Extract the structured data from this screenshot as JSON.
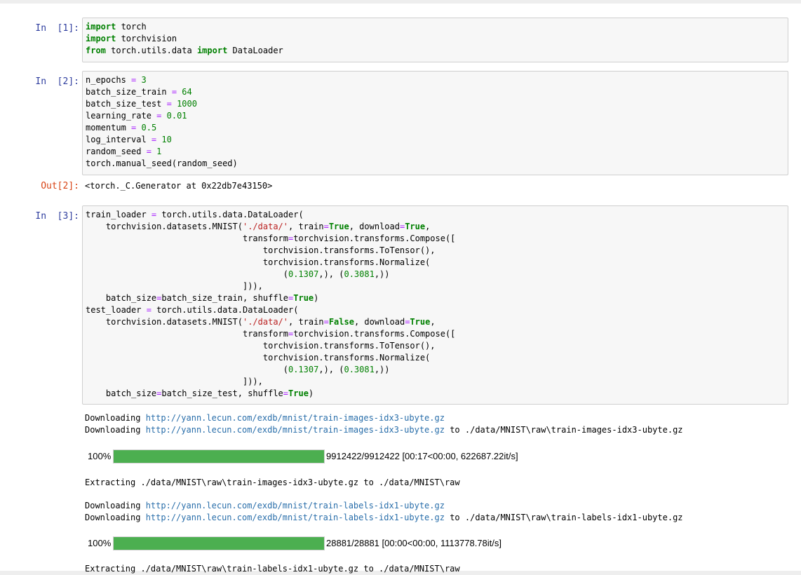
{
  "cells": {
    "c1": {
      "prompt": "In  [1]:",
      "lines": [
        [
          {
            "t": "import",
            "c": "kw"
          },
          {
            "t": " torch"
          }
        ],
        [
          {
            "t": "import",
            "c": "kw"
          },
          {
            "t": " torchvision"
          }
        ],
        [
          {
            "t": "from",
            "c": "kw"
          },
          {
            "t": " torch.utils.data "
          },
          {
            "t": "import",
            "c": "kw"
          },
          {
            "t": " DataLoader"
          }
        ]
      ]
    },
    "c2": {
      "prompt": "In  [2]:",
      "lines": [
        [
          {
            "t": "n_epochs "
          },
          {
            "t": "=",
            "c": "op"
          },
          {
            "t": " "
          },
          {
            "t": "3",
            "c": "num"
          }
        ],
        [
          {
            "t": "batch_size_train "
          },
          {
            "t": "=",
            "c": "op"
          },
          {
            "t": " "
          },
          {
            "t": "64",
            "c": "num"
          }
        ],
        [
          {
            "t": "batch_size_test "
          },
          {
            "t": "=",
            "c": "op"
          },
          {
            "t": " "
          },
          {
            "t": "1000",
            "c": "num"
          }
        ],
        [
          {
            "t": "learning_rate "
          },
          {
            "t": "=",
            "c": "op"
          },
          {
            "t": " "
          },
          {
            "t": "0.01",
            "c": "num"
          }
        ],
        [
          {
            "t": "momentum "
          },
          {
            "t": "=",
            "c": "op"
          },
          {
            "t": " "
          },
          {
            "t": "0.5",
            "c": "num"
          }
        ],
        [
          {
            "t": "log_interval "
          },
          {
            "t": "=",
            "c": "op"
          },
          {
            "t": " "
          },
          {
            "t": "10",
            "c": "num"
          }
        ],
        [
          {
            "t": "random_seed "
          },
          {
            "t": "=",
            "c": "op"
          },
          {
            "t": " "
          },
          {
            "t": "1",
            "c": "num"
          }
        ],
        [
          {
            "t": "torch.manual_seed(random_seed)"
          }
        ]
      ],
      "out_prompt": "Out[2]:",
      "output": "<torch._C.Generator at 0x22db7e43150>"
    },
    "c3": {
      "prompt": "In  [3]:",
      "lines": [
        [
          {
            "t": "train_loader "
          },
          {
            "t": "=",
            "c": "op"
          },
          {
            "t": " torch.utils.data.DataLoader("
          }
        ],
        [
          {
            "t": "    torchvision.datasets.MNIST("
          },
          {
            "t": "'./data/'",
            "c": "str"
          },
          {
            "t": ", train"
          },
          {
            "t": "=",
            "c": "op"
          },
          {
            "t": "True",
            "c": "kw"
          },
          {
            "t": ", download"
          },
          {
            "t": "=",
            "c": "op"
          },
          {
            "t": "True",
            "c": "kw"
          },
          {
            "t": ","
          }
        ],
        [
          {
            "t": "                               transform"
          },
          {
            "t": "=",
            "c": "op"
          },
          {
            "t": "torchvision.transforms.Compose(["
          }
        ],
        [
          {
            "t": "                                   torchvision.transforms.ToTensor(),"
          }
        ],
        [
          {
            "t": "                                   torchvision.transforms.Normalize("
          }
        ],
        [
          {
            "t": "                                       ("
          },
          {
            "t": "0.1307",
            "c": "num"
          },
          {
            "t": ",), ("
          },
          {
            "t": "0.3081",
            "c": "num"
          },
          {
            "t": ",))"
          }
        ],
        [
          {
            "t": "                               ])),"
          }
        ],
        [
          {
            "t": "    batch_size"
          },
          {
            "t": "=",
            "c": "op"
          },
          {
            "t": "batch_size_train, shuffle"
          },
          {
            "t": "=",
            "c": "op"
          },
          {
            "t": "True",
            "c": "kw"
          },
          {
            "t": ")"
          }
        ],
        [
          {
            "t": "test_loader "
          },
          {
            "t": "=",
            "c": "op"
          },
          {
            "t": " torch.utils.data.DataLoader("
          }
        ],
        [
          {
            "t": "    torchvision.datasets.MNIST("
          },
          {
            "t": "'./data/'",
            "c": "str"
          },
          {
            "t": ", train"
          },
          {
            "t": "=",
            "c": "op"
          },
          {
            "t": "False",
            "c": "kw"
          },
          {
            "t": ", download"
          },
          {
            "t": "=",
            "c": "op"
          },
          {
            "t": "True",
            "c": "kw"
          },
          {
            "t": ","
          }
        ],
        [
          {
            "t": "                               transform"
          },
          {
            "t": "=",
            "c": "op"
          },
          {
            "t": "torchvision.transforms.Compose(["
          }
        ],
        [
          {
            "t": "                                   torchvision.transforms.ToTensor(),"
          }
        ],
        [
          {
            "t": "                                   torchvision.transforms.Normalize("
          }
        ],
        [
          {
            "t": "                                       ("
          },
          {
            "t": "0.1307",
            "c": "num"
          },
          {
            "t": ",), ("
          },
          {
            "t": "0.3081",
            "c": "num"
          },
          {
            "t": ",))"
          }
        ],
        [
          {
            "t": "                               ])),"
          }
        ],
        [
          {
            "t": "    batch_size"
          },
          {
            "t": "=",
            "c": "op"
          },
          {
            "t": "batch_size_test, shuffle"
          },
          {
            "t": "=",
            "c": "op"
          },
          {
            "t": "True",
            "c": "kw"
          },
          {
            "t": ")"
          }
        ]
      ],
      "output": {
        "dl1a_prefix": "Downloading ",
        "dl1a_url": "http://yann.lecun.com/exdb/mnist/train-images-idx3-ubyte.gz",
        "dl1b_prefix": "Downloading ",
        "dl1b_url": "http://yann.lecun.com/exdb/mnist/train-images-idx3-ubyte.gz",
        "dl1b_suffix": " to ./data/MNIST\\raw\\train-images-idx3-ubyte.gz",
        "progress1": {
          "pct": "100%",
          "fraction": 1.0,
          "info": "9912422/9912422 [00:17<00:00, 622687.22it/s]"
        },
        "extract1": "Extracting ./data/MNIST\\raw\\train-images-idx3-ubyte.gz to ./data/MNIST\\raw",
        "dl2a_prefix": "Downloading ",
        "dl2a_url": "http://yann.lecun.com/exdb/mnist/train-labels-idx1-ubyte.gz",
        "dl2b_prefix": "Downloading ",
        "dl2b_url": "http://yann.lecun.com/exdb/mnist/train-labels-idx1-ubyte.gz",
        "dl2b_suffix": " to ./data/MNIST\\raw\\train-labels-idx1-ubyte.gz",
        "progress2": {
          "pct": "100%",
          "fraction": 1.0,
          "info": "28881/28881 [00:00<00:00, 1113778.78it/s]"
        },
        "extract2": "Extracting ./data/MNIST\\raw\\train-labels-idx1-ubyte.gz to ./data/MNIST\\raw"
      }
    }
  },
  "colors": {
    "keyword": "#008000",
    "operator": "#aa22ff",
    "number": "#008000",
    "string": "#ba2121",
    "in_prompt": "#303f9f",
    "out_prompt": "#d84315",
    "link": "#296eaa",
    "progress_fill": "#4caf50"
  }
}
